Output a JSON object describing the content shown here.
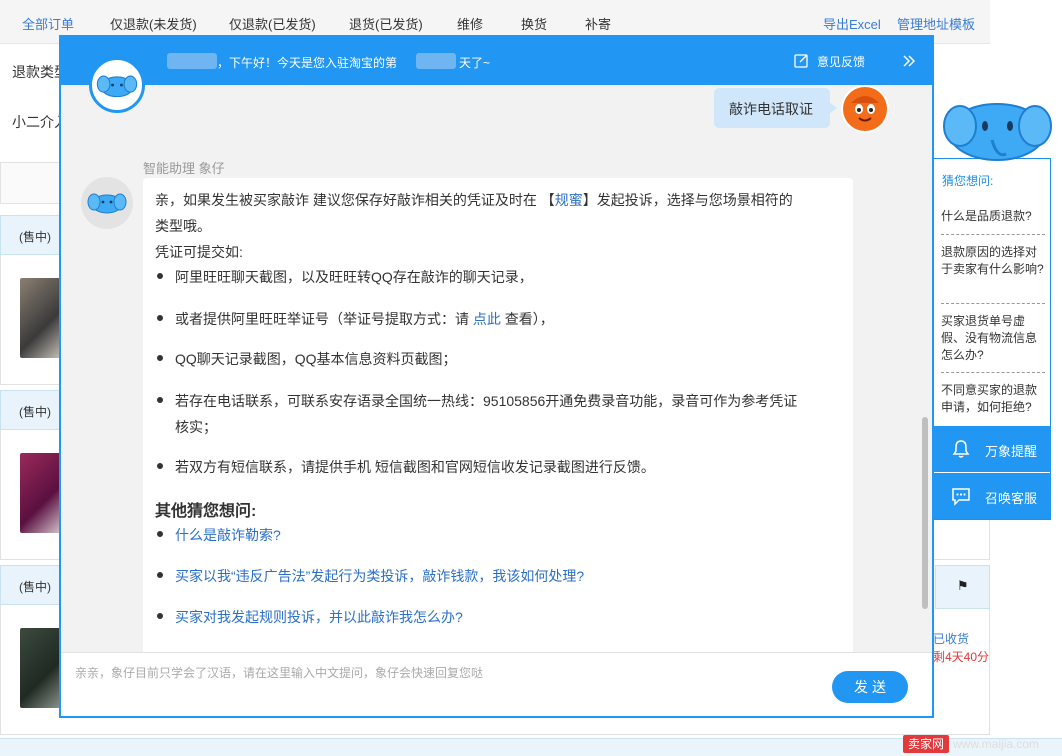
{
  "background": {
    "tabs": [
      {
        "label": "全部订单"
      },
      {
        "label": "仅退款(未发货)"
      },
      {
        "label": "仅退款(已发货)"
      },
      {
        "label": "退货(已发货)"
      },
      {
        "label": "维修"
      },
      {
        "label": "换货"
      },
      {
        "label": "补寄"
      }
    ],
    "export_label": "导出Excel",
    "address_template_label": "管理地址模板",
    "refund_type_label": "退款类型",
    "xiaoer_label": "小二介入",
    "status_badges": [
      "(售中)",
      "(售中)",
      "(售中)"
    ],
    "side_status_1": "已收货",
    "side_status_2": "剩4天40分",
    "watermark_a": "卖家网",
    "watermark_b": "www.maijia.com"
  },
  "side_panel": {
    "title": "猜您想问:",
    "questions": [
      "什么是品质退款?",
      "退款原因的选择对于卖家有什么影响?",
      "买家退货单号虚假、没有物流信息怎么办?",
      "不同意买家的退款申请，如何拒绝?"
    ],
    "reminder_label": "万象提醒",
    "call_service_label": "召唤客服"
  },
  "dialog": {
    "greeting_part1": "，下午好！今天是您入驻淘宝的第",
    "greeting_part2": "天了~",
    "feedback_label": "意见反馈",
    "user_message": "敲诈电话取证",
    "bot_name": "智能助理 象仔",
    "answer": {
      "intro_1": "亲，如果发生被买家敲诈 建议您保存好敲诈相关的凭证及时在",
      "intro_link_open": "【",
      "intro_link": "规蜜",
      "intro_link_close": "】",
      "intro_2": "发起投诉，选择与您场景相符的",
      "intro_3": "类型哦。",
      "evidence_title": "凭证可提交如:",
      "items": [
        "阿里旺旺聊天截图，以及旺旺转QQ存在敲诈的聊天记录，",
        "或者提供阿里旺旺举证号（举证号提取方式：请",
        "QQ聊天记录截图，QQ基本信息资料页截图；",
        "若存在电话联系，可联系安存语录全国统一热线：95105856开通免费录音功能，录音可作为参考凭证",
        "若双方有短信联系，请提供手机 短信截图和官网短信收发记录截图进行反馈。"
      ],
      "item2_link": "点此",
      "item2_tail": "查看），",
      "item4_tail": "核实；",
      "related_title": "其他猜您想问:",
      "related": [
        "什么是敲诈勒索?",
        "买家以我“违反广告法”发起行为类投诉，敲诈钱款，我该如何处理?",
        "买家对我发起规则投诉，并以此敲诈我怎么办?"
      ]
    },
    "input_placeholder": "亲亲，象仔目前只学会了汉语，请在这里输入中文提问，象仔会快速回复您哒",
    "send_label": "发送"
  }
}
